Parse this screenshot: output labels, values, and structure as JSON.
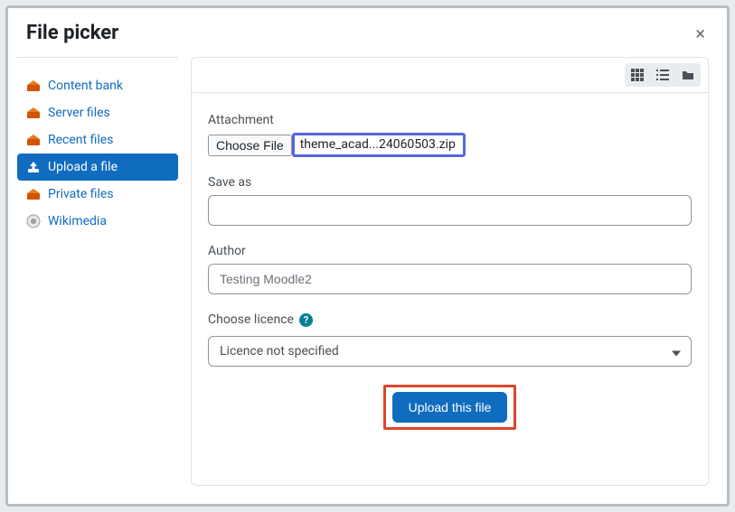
{
  "header": {
    "title": "File picker"
  },
  "sidebar": {
    "items": [
      {
        "label": "Content bank",
        "icon": "content-bank"
      },
      {
        "label": "Server files",
        "icon": "server-files"
      },
      {
        "label": "Recent files",
        "icon": "recent-files"
      },
      {
        "label": "Upload a file",
        "icon": "upload"
      },
      {
        "label": "Private files",
        "icon": "private-files"
      },
      {
        "label": "Wikimedia",
        "icon": "wikimedia"
      }
    ]
  },
  "form": {
    "attachment_label": "Attachment",
    "choose_file_label": "Choose File",
    "selected_file_name": "theme_acad...24060503.zip",
    "saveas_label": "Save as",
    "saveas_value": "",
    "author_label": "Author",
    "author_value": "Testing Moodle2",
    "licence_label": "Choose licence",
    "licence_value": "Licence not specified",
    "submit_label": "Upload this file"
  }
}
